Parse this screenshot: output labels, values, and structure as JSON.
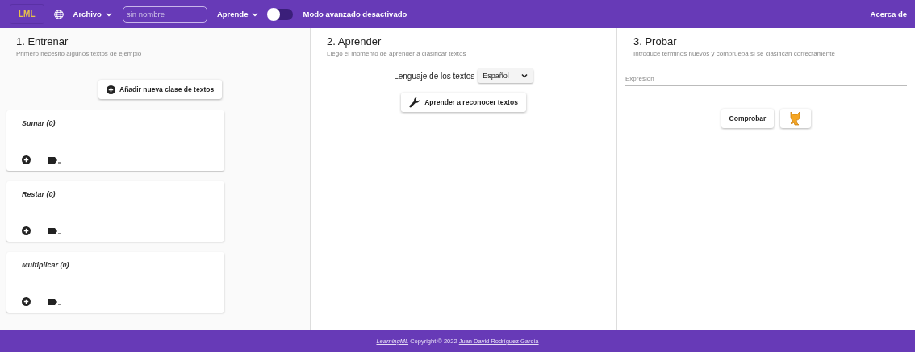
{
  "top_bar": {
    "logo": "LML",
    "file_menu": "Archivo",
    "name_field": {
      "placeholder": "sin nombre"
    },
    "learn_menu": "Aprende",
    "advanced_mode": {
      "on": false,
      "label": "Modo avanzado desactivado"
    },
    "about": "Acerca de"
  },
  "train": {
    "title": "1. Entrenar",
    "subtitle": "Primero necesito algunos textos de ejemplo",
    "add_class_button": "Añadir nueva clase de textos",
    "classes": [
      {
        "name": "Sumar (0)"
      },
      {
        "name": "Restar (0)"
      },
      {
        "name": "Multiplicar (0)"
      }
    ]
  },
  "learn": {
    "title": "2. Aprender",
    "subtitle": "Llegó el momento de aprender a clasificar textos",
    "language_label": "Lenguaje de los textos",
    "language_value": "Español",
    "learn_button": "Aprender a reconocer textos"
  },
  "test": {
    "title": "3. Probar",
    "subtitle": "Introduce términos nuevos y comprueba si se clasifican correctamente",
    "expression_field": {
      "placeholder": "Expresión"
    },
    "check_button": "Comprobar"
  },
  "footer": {
    "app_link": "LearningML",
    "text": "Copyright © 2022",
    "author_link": "Juan David Rodríguez García"
  }
}
